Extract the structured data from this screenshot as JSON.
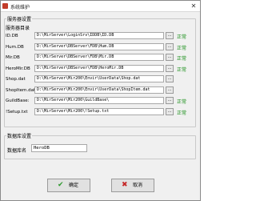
{
  "window": {
    "title": "系统维护",
    "close_glyph": "✕",
    "app_icon": "app-icon"
  },
  "server_group": {
    "title": "服务器设置",
    "dir_label": "服务器目录"
  },
  "rows": [
    {
      "label": "ID.DB",
      "value": "D:\\MirServer\\LoginSrv\\IDDB\\ID.DB",
      "status": "正常"
    },
    {
      "label": "Hum.DB",
      "value": "D:\\MirServer\\DBServer\\FDB\\Hum.DB",
      "status": "正常"
    },
    {
      "label": "Mir.DB",
      "value": "D:\\MirServer\\DBServer\\FDB\\Mir.DB",
      "status": "正常"
    },
    {
      "label": "HeroMir.DB",
      "value": "D:\\MirServer\\DBServer\\FDB\\HeroMir.DB",
      "status": "正常"
    },
    {
      "label": "Shop.dat",
      "value": "D:\\MirServer\\Mir200\\Envir\\UserData\\Shop.dat",
      "status": ""
    },
    {
      "label": "ShopItem.dat",
      "value": "D:\\MirServer\\Mir200\\Envir\\UserData\\ShopItem.dat",
      "status": ""
    },
    {
      "label": "GuildBase:",
      "value": "D:\\MirServer\\Mir200\\GuildBase\\",
      "status": "正常"
    },
    {
      "label": "!Setup.txt",
      "value": "D:\\MirServer\\Mir200\\!Setup.txt",
      "status": "正常"
    }
  ],
  "browse_label": "...",
  "db_group": {
    "title": "数据库设置",
    "db_name_label": "数据库名",
    "db_name_value": "HeroDB"
  },
  "buttons": {
    "ok_label": "确定",
    "ok_glyph": "✔",
    "cancel_label": "取消",
    "cancel_glyph": "✖"
  },
  "colors": {
    "status_ok": "#1a8f1a",
    "ok_icon": "#2e9a2e",
    "cancel_icon": "#c62828"
  }
}
